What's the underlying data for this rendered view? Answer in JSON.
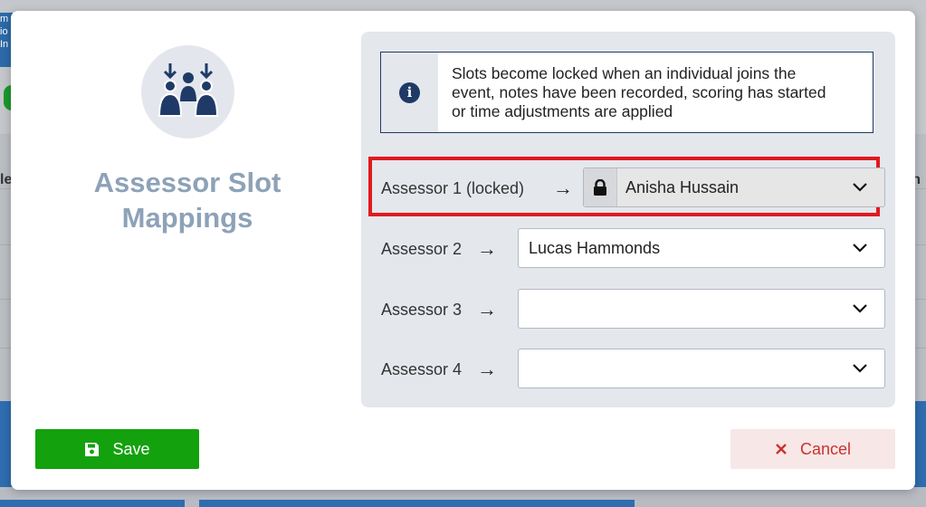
{
  "background": {
    "left_text": "m io In",
    "edge_left": "le",
    "edge_right": "n"
  },
  "modal": {
    "title": "Assessor Slot Mappings",
    "header_icon": "people-group-icon",
    "info": {
      "icon": "info-icon",
      "text": "Slots become locked when an individual joins the event, notes have been recorded, scoring has started or time adjustments are applied"
    },
    "slots": [
      {
        "label": "Assessor 1 (locked)",
        "value": "Anisha Hussain",
        "locked": true
      },
      {
        "label": "Assessor 2",
        "value": "Lucas Hammonds",
        "locked": false
      },
      {
        "label": "Assessor 3",
        "value": "",
        "locked": false
      },
      {
        "label": "Assessor 4",
        "value": "",
        "locked": false
      }
    ],
    "buttons": {
      "save_label": "Save",
      "cancel_label": "Cancel"
    },
    "colors": {
      "save_bg": "#14a10e",
      "cancel_text": "#c9332e",
      "highlight": "#e0191f",
      "title": "#8da2b8",
      "navy": "#1f3a66"
    }
  }
}
